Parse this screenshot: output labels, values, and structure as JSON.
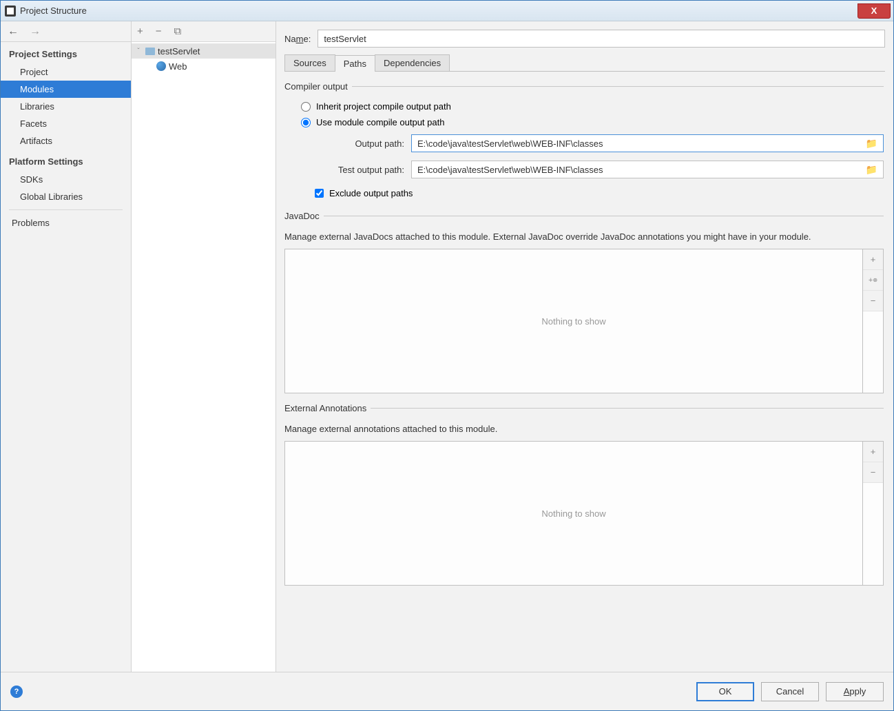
{
  "window": {
    "title": "Project Structure",
    "close": "X"
  },
  "nav": {
    "section1": "Project Settings",
    "items1": [
      "Project",
      "Modules",
      "Libraries",
      "Facets",
      "Artifacts"
    ],
    "selected1": 1,
    "section2": "Platform Settings",
    "items2": [
      "SDKs",
      "Global Libraries"
    ],
    "problems": "Problems"
  },
  "tree": {
    "plus": "+",
    "minus": "−",
    "copy": "⧉",
    "root": "testServlet",
    "child": "Web"
  },
  "detail": {
    "name_label_pre": "Na",
    "name_label_ul": "m",
    "name_label_post": "e:",
    "name_value": "testServlet",
    "tabs": [
      "Sources",
      "Paths",
      "Dependencies"
    ],
    "active_tab": 1,
    "compiler": {
      "legend": "Compiler output",
      "radio1": "Inherit project compile output path",
      "radio2": "Use module compile output path",
      "selected_radio": 2,
      "output_label": "Output path:",
      "output_value": "E:\\code\\java\\testServlet\\web\\WEB-INF\\classes",
      "test_output_label": "Test output path:",
      "test_output_value": "E:\\code\\java\\testServlet\\web\\WEB-INF\\classes",
      "exclude_label": "Exclude output paths",
      "exclude_checked": true
    },
    "javadoc": {
      "legend": "JavaDoc",
      "desc": "Manage external JavaDocs attached to this module. External JavaDoc override JavaDoc annotations you might have in your module.",
      "empty": "Nothing to show"
    },
    "annotations": {
      "legend": "External Annotations",
      "desc": "Manage external annotations attached to this module.",
      "empty": "Nothing to show"
    }
  },
  "footer": {
    "help": "?",
    "ok": "OK",
    "cancel": "Cancel",
    "apply_ul": "A",
    "apply_rest": "pply"
  }
}
